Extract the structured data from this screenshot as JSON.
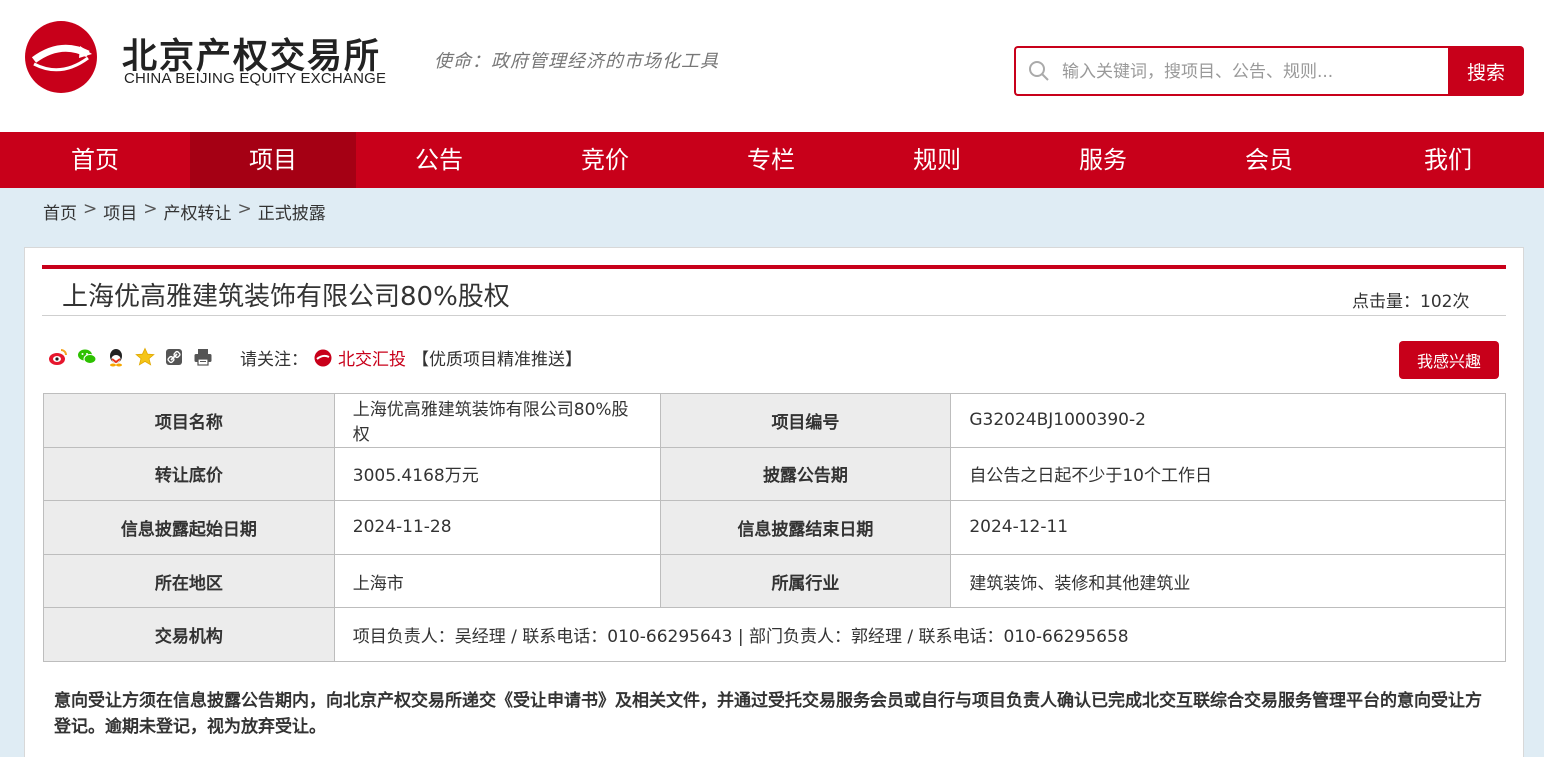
{
  "header": {
    "logo_cn": "北京产权交易所",
    "logo_en": "CHINA BEIJING EQUITY EXCHANGE",
    "mission": "使命：政府管理经济的市场化工具",
    "search_placeholder": "输入关键词，搜项目、公告、规则...",
    "search_button": "搜索"
  },
  "nav": {
    "items": [
      "首页",
      "项目",
      "公告",
      "竞价",
      "专栏",
      "规则",
      "服务",
      "会员",
      "我们"
    ],
    "active_index": 1
  },
  "breadcrumb": [
    "首页",
    "项目",
    "产权转让",
    "正式披露"
  ],
  "breadcrumb_sep": ">",
  "project": {
    "title": "上海优高雅建筑装饰有限公司80%股权",
    "hits": "点击量：102次"
  },
  "share": {
    "icons": [
      "weibo-icon",
      "wechat-icon",
      "qq-icon",
      "favorite-star-icon",
      "link-icon",
      "print-icon"
    ],
    "follow_label": "请关注：",
    "follow_brand": "北交汇投",
    "follow_tag": "【优质项目精准推送】",
    "interest_button": "我感兴趣"
  },
  "table": {
    "rows": [
      {
        "l1": "项目名称",
        "v1": "上海优高雅建筑装饰有限公司80%股权",
        "l2": "项目编号",
        "v2": "G32024BJ1000390-2"
      },
      {
        "l1": "转让底价",
        "v1": "3005.4168万元",
        "l2": "披露公告期",
        "v2": "自公告之日起不少于10个工作日"
      },
      {
        "l1": "信息披露起始日期",
        "v1": "2024-11-28",
        "l2": "信息披露结束日期",
        "v2": "2024-12-11"
      },
      {
        "l1": "所在地区",
        "v1": "上海市",
        "l2": "所属行业",
        "v2": "建筑装饰、装修和其他建筑业"
      }
    ],
    "contact_label": "交易机构",
    "contact_value": "项目负责人：吴经理 / 联系电话：010-66295643 | 部门负责人：郭经理 / 联系电话：010-66295658"
  },
  "notice": "意向受让方须在信息披露公告期内，向北京产权交易所递交《受让申请书》及相关文件，并通过受托交易服务会员或自行与项目负责人确认已完成北交互联综合交易服务管理平台的意向受让方登记。逾期未登记，视为放弃受让。",
  "colors": {
    "brand_red": "#c8001a",
    "nav_active": "#a50014",
    "crumb_bg": "#dfecf4",
    "label_bg": "#ececec"
  }
}
